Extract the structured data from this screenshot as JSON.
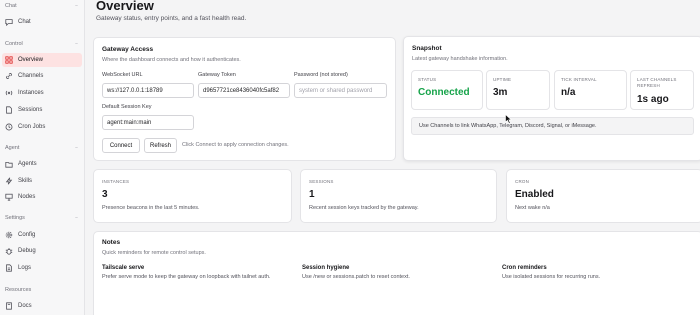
{
  "sidebar": {
    "sections": {
      "chat": "Chat",
      "control": "Control",
      "agent": "Agent",
      "settings": "Settings",
      "resources": "Resources"
    },
    "items": {
      "chat": "Chat",
      "overview": "Overview",
      "channels": "Channels",
      "instances": "Instances",
      "sessions": "Sessions",
      "cron_jobs": "Cron Jobs",
      "agents": "Agents",
      "skills": "Skills",
      "nodes": "Nodes",
      "config": "Config",
      "debug": "Debug",
      "logs": "Logs",
      "docs": "Docs"
    },
    "active": "overview"
  },
  "header": {
    "title": "Overview",
    "subtitle": "Gateway status, entry points, and a fast health read."
  },
  "gateway_access": {
    "title": "Gateway Access",
    "subtitle": "Where the dashboard connects and how it authenticates.",
    "websocket_label": "WebSocket URL",
    "websocket_value": "ws://127.0.0.1:18789",
    "token_label": "Gateway Token",
    "token_value": "d9657721ce8436040fc5af82",
    "password_label": "Password (not stored)",
    "password_placeholder": "system or shared password",
    "session_key_label": "Default Session Key",
    "session_key_value": "agent:main:main",
    "connect_label": "Connect",
    "refresh_label": "Refresh",
    "hint": "Click Connect to apply connection changes."
  },
  "snapshot": {
    "title": "Snapshot",
    "subtitle": "Latest gateway handshake information.",
    "status_label": "STATUS",
    "status_value": "Connected",
    "uptime_label": "UPTIME",
    "uptime_value": "3m",
    "tick_label": "TICK INTERVAL",
    "tick_value": "n/a",
    "refresh_label_l1": "LAST CHANNELS",
    "refresh_label_l2": "REFRESH",
    "refresh_value": "1s ago",
    "info": "Use Channels to link WhatsApp, Telegram, Discord, Signal, or iMessage."
  },
  "instances": {
    "label": "INSTANCES",
    "value": "3",
    "sub": "Presence beacons in the last 5 minutes."
  },
  "sessions": {
    "label": "SESSIONS",
    "value": "1",
    "sub": "Recent session keys tracked by the gateway."
  },
  "cron": {
    "label": "CRON",
    "value": "Enabled",
    "sub": "Next wake n/a"
  },
  "notes": {
    "title": "Notes",
    "subtitle": "Quick reminders for remote control setups.",
    "items": [
      {
        "title": "Tailscale serve",
        "text": "Prefer serve mode to keep the gateway on loopback with tailnet auth."
      },
      {
        "title": "Session hygiene",
        "text": "Use /new or sessions.patch to reset context."
      },
      {
        "title": "Cron reminders",
        "text": "Use isolated sessions for recurring runs."
      }
    ]
  },
  "colors": {
    "active_bg": "#fde2e2",
    "accent": "#dc2626",
    "connected": "#16a34a"
  }
}
